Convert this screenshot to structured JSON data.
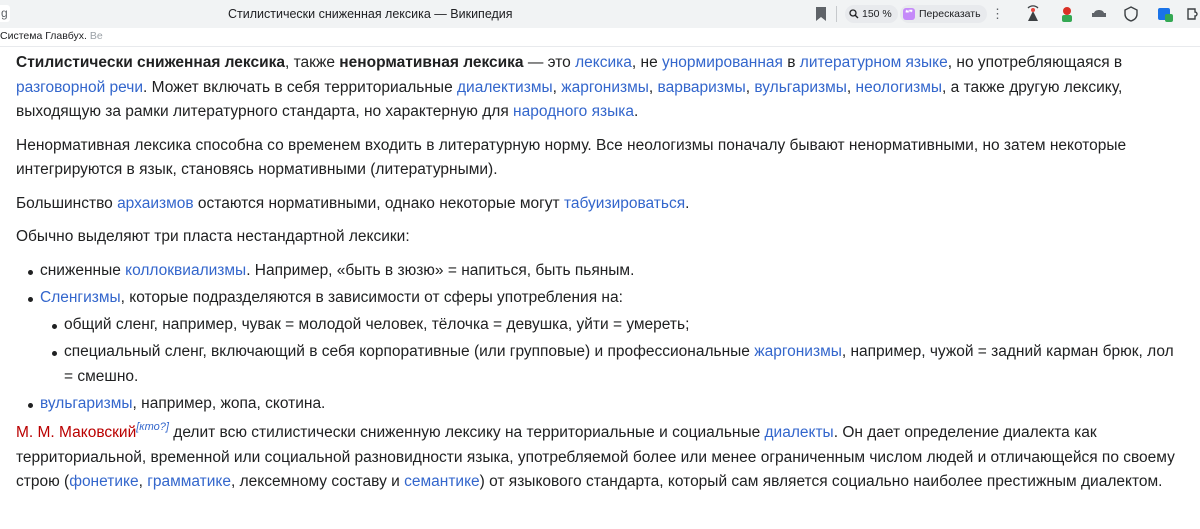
{
  "browser": {
    "address_fragment": "g",
    "tab_title": "Стилистически сниженная лексика — Википедия",
    "zoom": "150 %",
    "retell_label": "Пересказать",
    "bookmark_bar_text": "Система Главбух. ",
    "bookmark_bar_faded": "Ве"
  },
  "article": {
    "p1": {
      "s1": "Стилистически сниженная лексика",
      "s2": ", также ",
      "s3": "ненормативная лексика",
      "s4": " — это ",
      "l1": "лексика",
      "s5": ", не ",
      "l2": "унормированная",
      "s6": " в ",
      "l3": "литературном языке",
      "s7": ", но употребляющаяся в ",
      "l4": "разговорной речи",
      "s8": ". Может включать в себя территориальные ",
      "l5": "диалектизмы",
      "s9": ", ",
      "l6": "жаргонизмы",
      "s10": ", ",
      "l7": "варваризмы",
      "s11": ", ",
      "l8": "вульгаризмы",
      "s12": ", ",
      "l9": "неологизмы",
      "s13": ", а также другую лексику, выходящую за рамки литературного стандарта, но характерную для ",
      "l10": "народного языка",
      "s14": "."
    },
    "p2": "Ненормативная лексика способна со временем входить в литературную норму. Все неологизмы поначалу бывают ненормативными, но затем некоторые интегрируются в язык, становясь нормативными (литературными).",
    "p3": {
      "s1": "Большинство ",
      "l1": "архаизмов",
      "s2": " остаются нормативными, однако некоторые могут ",
      "l2": "табуизироваться",
      "s3": "."
    },
    "p4": "Обычно выделяют три пласта нестандартной лексики:",
    "list": {
      "i1": {
        "s1": "сниженные ",
        "l1": "коллоквиализмы",
        "s2": ". Например, «быть в зюзю» = напиться, быть пьяным."
      },
      "i2": {
        "l1": "Сленгизмы",
        "s1": ", которые подразделяются в зависимости от сферы употребления на:"
      },
      "i2a": "общий сленг, например, чувак = молодой человек, тёлочка = девушка, уйти = умереть;",
      "i2b": {
        "s1": "специальный сленг, включающий в себя корпоративные (или групповые) и профессиональные ",
        "l1": "жаргонизмы",
        "s2": ", например, чужой = задний карман брюк, лол = смешно."
      },
      "i3": {
        "l1": "вульгаризмы",
        "s1": ", например, жопа, скотина."
      }
    },
    "p5": {
      "l1": "М. М. Маковский",
      "sup": "[кто?]",
      "s1": " делит всю стилистически сниженную лексику на территориальные и социальные ",
      "l2": "диалекты",
      "s2": ". Он дает определение диалекта как территориальной, временной или социальной разновидности языка, употребляемой более или менее ограниченным числом людей и отличающейся по своему строю (",
      "l3": "фонетике",
      "s3": ", ",
      "l4": "грамматике",
      "s4": ", лексемному составу и ",
      "l5": "семантике",
      "s5": ") от языкового стандарта, который сам является социально наиболее престижным диалектом."
    }
  },
  "colors": {
    "link": "#3366cc",
    "redlink": "#ba0000",
    "text": "#202122"
  }
}
